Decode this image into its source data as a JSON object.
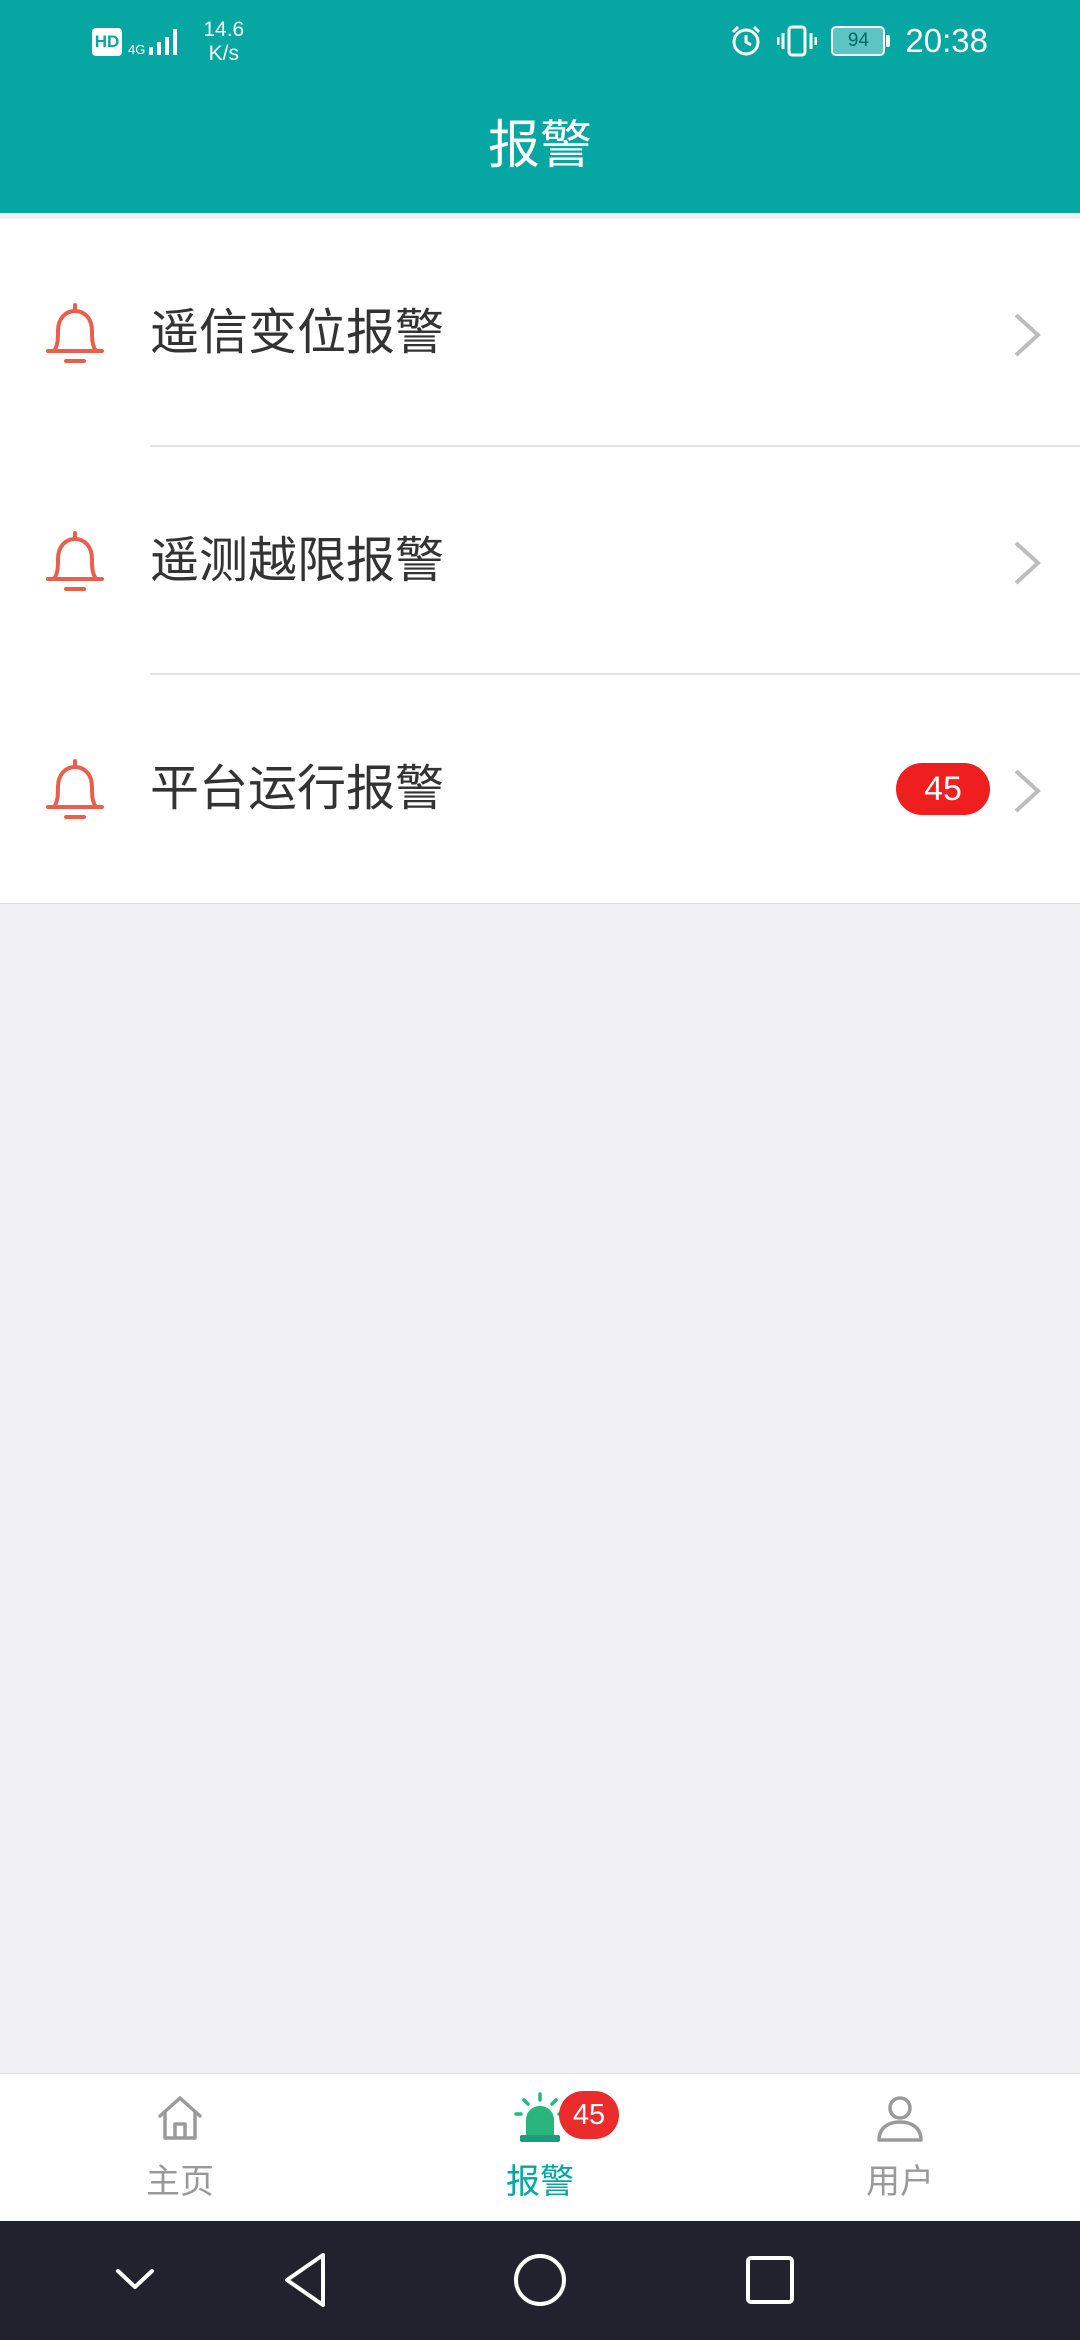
{
  "status_bar": {
    "hd": "HD",
    "network_type": "4G",
    "speed_value": "14.6",
    "speed_unit": "K/s",
    "battery": "94",
    "time": "20:38"
  },
  "header": {
    "title": "报警"
  },
  "alarm_list": [
    {
      "label": "遥信变位报警",
      "icon": "bell-icon",
      "badge": ""
    },
    {
      "label": "遥测越限报警",
      "icon": "bell-icon",
      "badge": ""
    },
    {
      "label": "平台运行报警",
      "icon": "bell-icon",
      "badge": "45"
    }
  ],
  "tabbar": {
    "tabs": [
      {
        "label": "主页",
        "icon": "home-icon",
        "active": false
      },
      {
        "label": "报警",
        "icon": "alarm-siren-icon",
        "active": true,
        "badge": "45"
      },
      {
        "label": "用户",
        "icon": "user-icon",
        "active": false
      }
    ]
  },
  "colors": {
    "primary": "#06a6a3",
    "bell": "#e8604c",
    "badge": "#f01f1f",
    "inactive": "#999999"
  }
}
